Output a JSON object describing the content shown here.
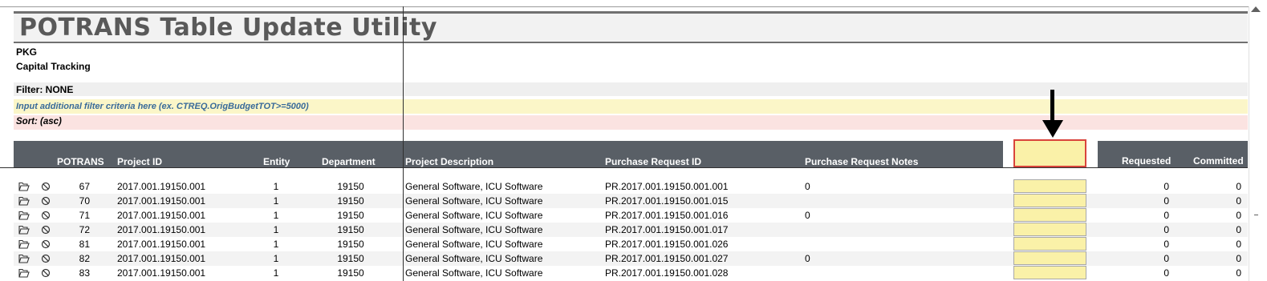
{
  "title": "POTRANS Table Update Utility",
  "company": "PKG",
  "module": "Capital Tracking",
  "filter_label": "Filter: NONE",
  "input_hint": "Input additional filter criteria here (ex. CTREQ.OrigBudgetTOT>=5000)",
  "sort_label": "Sort:  (asc)",
  "columns": {
    "potrans": "POTRANS",
    "project_id": "Project ID",
    "entity": "Entity",
    "department": "Department",
    "project_description": "Project Description",
    "purchase_request_id": "Purchase Request ID",
    "purchase_request_notes": "Purchase Request Notes",
    "highlight_input": "",
    "requested": "Requested",
    "committed": "Committed"
  },
  "rows": [
    {
      "potrans": "67",
      "project_id": "2017.001.19150.001",
      "entity": "1",
      "department": "19150",
      "description": "General Software, ICU Software",
      "pr_id": "PR.2017.001.19150.001.001",
      "notes": "0",
      "requested": "0",
      "committed": "0"
    },
    {
      "potrans": "70",
      "project_id": "2017.001.19150.001",
      "entity": "1",
      "department": "19150",
      "description": "General Software, ICU Software",
      "pr_id": "PR.2017.001.19150.001.015",
      "notes": "",
      "requested": "0",
      "committed": "0"
    },
    {
      "potrans": "71",
      "project_id": "2017.001.19150.001",
      "entity": "1",
      "department": "19150",
      "description": "General Software, ICU Software",
      "pr_id": "PR.2017.001.19150.001.016",
      "notes": "0",
      "requested": "0",
      "committed": "0"
    },
    {
      "potrans": "72",
      "project_id": "2017.001.19150.001",
      "entity": "1",
      "department": "19150",
      "description": "General Software, ICU Software",
      "pr_id": "PR.2017.001.19150.001.017",
      "notes": "",
      "requested": "0",
      "committed": "0"
    },
    {
      "potrans": "81",
      "project_id": "2017.001.19150.001",
      "entity": "1",
      "department": "19150",
      "description": "General Software, ICU Software",
      "pr_id": "PR.2017.001.19150.001.026",
      "notes": "",
      "requested": "0",
      "committed": "0"
    },
    {
      "potrans": "82",
      "project_id": "2017.001.19150.001",
      "entity": "1",
      "department": "19150",
      "description": "General Software, ICU Software",
      "pr_id": "PR.2017.001.19150.001.027",
      "notes": "0",
      "requested": "0",
      "committed": "0"
    },
    {
      "potrans": "83",
      "project_id": "2017.001.19150.001",
      "entity": "1",
      "department": "19150",
      "description": "General Software, ICU Software",
      "pr_id": "PR.2017.001.19150.001.028",
      "notes": "",
      "requested": "0",
      "committed": "0"
    }
  ],
  "icons": {
    "open": "folder-open-icon",
    "cancel": "prohibit-icon",
    "indicator": "down-arrow-icon"
  },
  "colors": {
    "header_bg": "#595f66",
    "input_yellow": "#faf1a8",
    "highlight_border": "#d9443c",
    "sort_pink": "#fbe3e1",
    "hint_blue": "#3a6b9a"
  }
}
